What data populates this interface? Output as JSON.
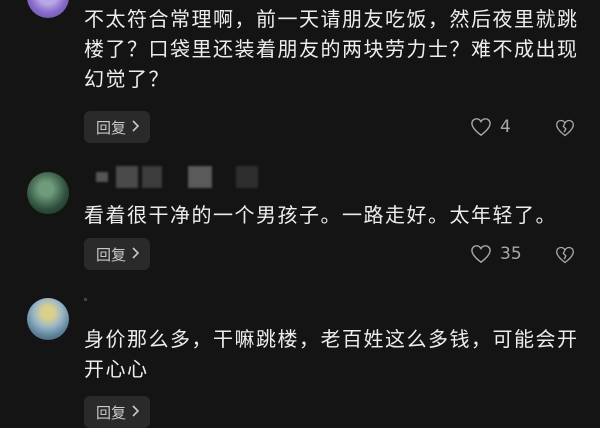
{
  "comments": [
    {
      "text": "不太符合常理啊，前一天请朋友吃饭，然后夜里就跳楼了？口袋里还装着朋友的两块劳力士？难不成出现幻觉了？",
      "reply_label": "回复",
      "like_count": "4"
    },
    {
      "text": "看着很干净的一个男孩子。一路走好。太年轻了。",
      "reply_label": "回复",
      "like_count": "35"
    },
    {
      "text": "身价那么多，干嘛跳楼，老百姓这么多钱，可能会开开心心",
      "reply_label": "回复"
    }
  ],
  "colors": {
    "background": "#141414",
    "text": "#ededed",
    "muted": "#a8a8a8",
    "button_bg": "#2a2a2a"
  },
  "icons": [
    "heart-outline-icon",
    "broken-heart-icon",
    "chevron-right-icon"
  ]
}
